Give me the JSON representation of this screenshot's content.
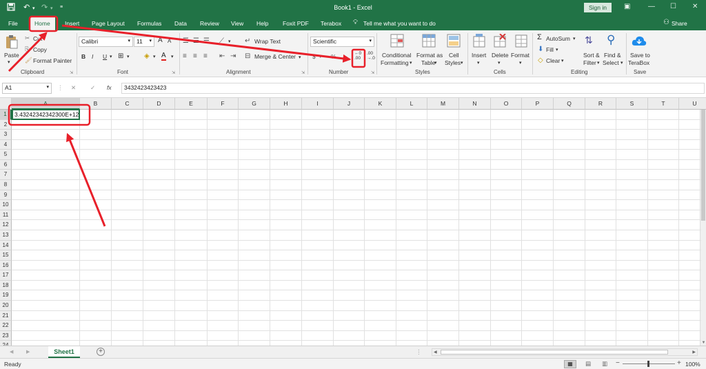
{
  "app": {
    "title": "Book1 - Excel",
    "sign_in": "Sign in",
    "share": "Share"
  },
  "tabs": [
    "File",
    "Home",
    "Insert",
    "Page Layout",
    "Formulas",
    "Data",
    "Review",
    "View",
    "Help",
    "Foxit PDF",
    "Terabox"
  ],
  "active_tab": "Home",
  "tell_me": "Tell me what you want to do",
  "ribbon": {
    "clipboard": {
      "label": "Clipboard",
      "paste": "Paste",
      "cut": "Cut",
      "copy": "Copy",
      "format_painter": "Format Painter"
    },
    "font": {
      "label": "Font",
      "font_name": "Calibri",
      "font_size": "11",
      "bold": "B",
      "italic": "I",
      "underline": "U",
      "grow": "A",
      "shrink": "A",
      "font_color": "A"
    },
    "alignment": {
      "label": "Alignment",
      "wrap_text": "Wrap Text",
      "merge_center": "Merge & Center"
    },
    "number": {
      "label": "Number",
      "format": "Scientific",
      "currency": "$",
      "percent": "%",
      "comma": ",",
      "increase_decimal_top": "←0",
      "increase_decimal_bottom": ".00",
      "decrease_decimal_top": ".00",
      "decrease_decimal_bottom": "→.0"
    },
    "styles": {
      "label": "Styles",
      "conditional": "Conditional",
      "conditional2": "Formatting",
      "format_as": "Format as",
      "format_as2": "Table",
      "cell": "Cell",
      "cell2": "Styles"
    },
    "cells": {
      "label": "Cells",
      "insert": "Insert",
      "delete": "Delete",
      "format": "Format"
    },
    "editing": {
      "label": "Editing",
      "autosum": "AutoSum",
      "fill": "Fill",
      "clear": "Clear",
      "sort": "Sort &",
      "sort2": "Filter",
      "find": "Find &",
      "find2": "Select"
    },
    "save": {
      "label": "Save",
      "save_to": "Save to",
      "save_to2": "TeraBox"
    }
  },
  "formula_bar": {
    "name_box": "A1",
    "cancel": "✕",
    "enter": "✓",
    "fx": "fx",
    "value": "3432423423423"
  },
  "grid": {
    "columns": [
      "A",
      "B",
      "C",
      "D",
      "E",
      "F",
      "G",
      "H",
      "I",
      "J",
      "K",
      "L",
      "M",
      "N",
      "O",
      "P",
      "Q",
      "R",
      "S",
      "T",
      "U"
    ],
    "rows": [
      "1",
      "2",
      "3",
      "4",
      "5",
      "6",
      "7",
      "8",
      "9",
      "10",
      "11",
      "12",
      "13",
      "14",
      "15",
      "16",
      "17",
      "18",
      "19",
      "20",
      "21",
      "22",
      "23",
      "24"
    ],
    "a1_display": "3.43242342342300E+12"
  },
  "sheets": [
    "Sheet1"
  ],
  "add_sheet": "+",
  "status": {
    "ready": "Ready",
    "zoom_minus": "−",
    "zoom_plus": "+",
    "zoom": "100%"
  },
  "colors": {
    "excel_green": "#217346",
    "annotation_red": "#e8202a"
  }
}
